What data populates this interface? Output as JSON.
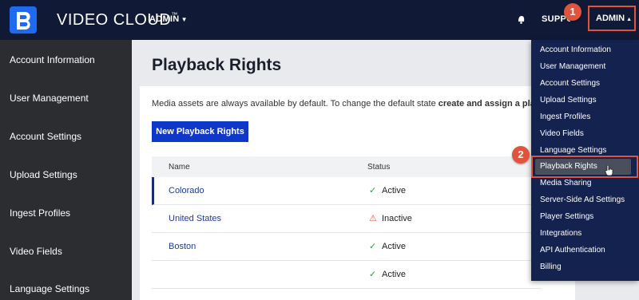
{
  "header": {
    "brand": "VIDEO CLOUD",
    "brand_tm": "™",
    "admin_menu": "ADMIN",
    "support": "SUPPORT",
    "admin_right": "ADMIN",
    "caret_down": "▼",
    "caret_up": "▲"
  },
  "callouts": {
    "one": "1",
    "two": "2"
  },
  "sidebar": {
    "items": [
      {
        "label": "Account Information"
      },
      {
        "label": "User Management"
      },
      {
        "label": "Account Settings"
      },
      {
        "label": "Upload Settings"
      },
      {
        "label": "Ingest Profiles"
      },
      {
        "label": "Video Fields"
      },
      {
        "label": "Language Settings"
      }
    ]
  },
  "main": {
    "title": "Playback Rights",
    "intro_text": "Media assets are always available by default. To change the default state ",
    "intro_bold": "create and assign a playback",
    "new_button": "New Playback Rights",
    "table": {
      "headers": {
        "name": "Name",
        "status": "Status"
      },
      "rows": [
        {
          "name": "Colorado",
          "status": "Active",
          "status_icon": "✓",
          "state": "active"
        },
        {
          "name": "United States",
          "status": "Inactive",
          "status_icon": "⚠",
          "state": "inactive"
        },
        {
          "name": "Boston",
          "status": "Active",
          "status_icon": "✓",
          "state": "active"
        },
        {
          "name": "",
          "status": "Active",
          "status_icon": "✓",
          "state": "active"
        }
      ]
    }
  },
  "dropdown": {
    "items": [
      {
        "label": "Account Information"
      },
      {
        "label": "User Management"
      },
      {
        "label": "Account Settings"
      },
      {
        "label": "Upload Settings"
      },
      {
        "label": "Ingest Profiles"
      },
      {
        "label": "Video Fields"
      },
      {
        "label": "Language Settings"
      },
      {
        "label": "Playback Rights"
      },
      {
        "label": "Media Sharing"
      },
      {
        "label": "Server-Side Ad Settings"
      },
      {
        "label": "Player Settings"
      },
      {
        "label": "Integrations"
      },
      {
        "label": "API Authentication"
      },
      {
        "label": "Billing"
      }
    ]
  },
  "colors": {
    "topbar": "#101935",
    "accent_button": "#0f37c8",
    "callout": "#e0533c",
    "active_green": "#2f9a4a",
    "dropdown_bg": "#14224f"
  }
}
